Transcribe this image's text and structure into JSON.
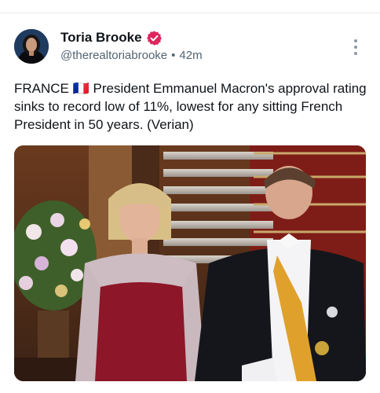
{
  "post": {
    "author": {
      "display_name": "Toria Brooke",
      "verified": true,
      "handle": "@therealtoriabrooke",
      "separator": "•",
      "time": "42m"
    },
    "text": "FRANCE 🇫🇷 President Emmanuel Macron's approval rating sinks to record low of 11%, lowest for any sitting French President in 50 years. (Verian)",
    "media": {
      "kind": "photo"
    }
  },
  "colors": {
    "verified_badge": "#e0245e",
    "secondary_text": "#536471",
    "divider": "#e7e9ea"
  },
  "icons": {
    "verified": "verified-badge-icon",
    "more": "more-options-icon"
  }
}
